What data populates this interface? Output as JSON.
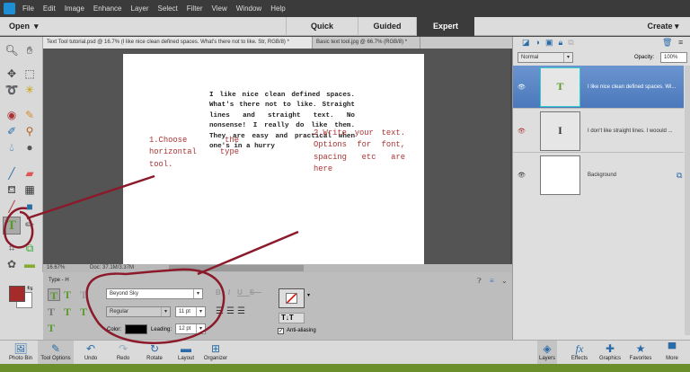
{
  "menubar": {
    "items": [
      "File",
      "Edit",
      "Image",
      "Enhance",
      "Layer",
      "Select",
      "Filter",
      "View",
      "Window",
      "Help"
    ]
  },
  "modebar": {
    "open": "Open",
    "modes": [
      "Quick",
      "Guided",
      "Expert"
    ],
    "create": "Create"
  },
  "tabs": [
    {
      "label": "Text Tool tutorial.psd @ 16.7% (I like nice clean defined spaces. What's there not to like. Str, RGB/8) *"
    },
    {
      "label": "Basic text tool.jpg @ 66.7% (RGB/8) *"
    }
  ],
  "document": {
    "body_text": "I like nice clean defined spaces. What's there not to like. Straight lines and straight text. No nonsense! I really do like them. They are easy and practical when one's in a hurry",
    "note1": "1.Choose the horizontal type tool.",
    "note2": "2.Write your text. Options for font, spacing etc are here"
  },
  "status": {
    "zoom": "16.67%",
    "doc": "Doc: 37.1M/3.37M"
  },
  "tool_options": {
    "title": "Type - H",
    "font": "Beyond Sky",
    "style": "Regular",
    "size": "11 pt",
    "color_label": "Color:",
    "leading_label": "Leading:",
    "leading": "12 pt",
    "anti_alias": "Anti-aliasing",
    "anti_alias_checked": true
  },
  "layers_panel": {
    "blend": "Normal",
    "opacity_label": "Opacity:",
    "opacity": "100%",
    "layers": [
      {
        "name": "I like nice clean defined spaces. Wi...",
        "selected": true
      },
      {
        "name": "I don't like straight lines. I woould ...",
        "selected": false
      },
      {
        "name": "Background",
        "selected": false
      }
    ]
  },
  "bottombar": {
    "left": [
      "Photo Bin",
      "Tool Options",
      "Undo",
      "Redo",
      "Rotate",
      "Layout",
      "Organizer"
    ],
    "right": [
      "Layers",
      "Effects",
      "Graphics",
      "Favorites",
      "More"
    ]
  },
  "colors": {
    "foreground": "#a52a2a",
    "annotation": "#8b1a2b",
    "accent": "#4a78bb"
  }
}
